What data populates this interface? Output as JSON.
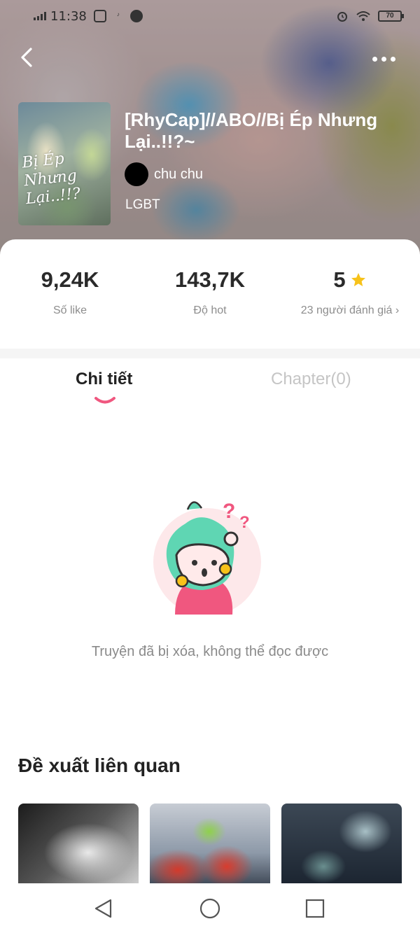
{
  "status_bar": {
    "time": "11:38",
    "battery": "70"
  },
  "story": {
    "title": "[RhyCap]//ABO//Bị Ép Nhưng Lại..!!?~",
    "author": "chu chu",
    "tag": "LGBT",
    "cover_text": "Bị Ép Nhưng Lại..!!?"
  },
  "stats": {
    "likes": {
      "value": "9,24K",
      "label": "Số like"
    },
    "hot": {
      "value": "143,7K",
      "label": "Độ hot"
    },
    "rating": {
      "value": "5",
      "label": "23 người đánh giá",
      "chevron": "›"
    }
  },
  "tabs": [
    {
      "label": "Chi tiết",
      "active": true
    },
    {
      "label": "Chapter(0)",
      "active": false
    }
  ],
  "empty_state": {
    "message": "Truyện đã bị xóa, không thể đọc được"
  },
  "related": {
    "title": "Đề xuất liên quan",
    "items": [
      {
        "icon": "cover-image-hands"
      },
      {
        "icon": "cover-image-group"
      },
      {
        "icon": "cover-image-stage"
      }
    ]
  },
  "colors": {
    "accent": "#f0577f",
    "star": "#f7c21a",
    "muted": "#8d8d8d"
  }
}
